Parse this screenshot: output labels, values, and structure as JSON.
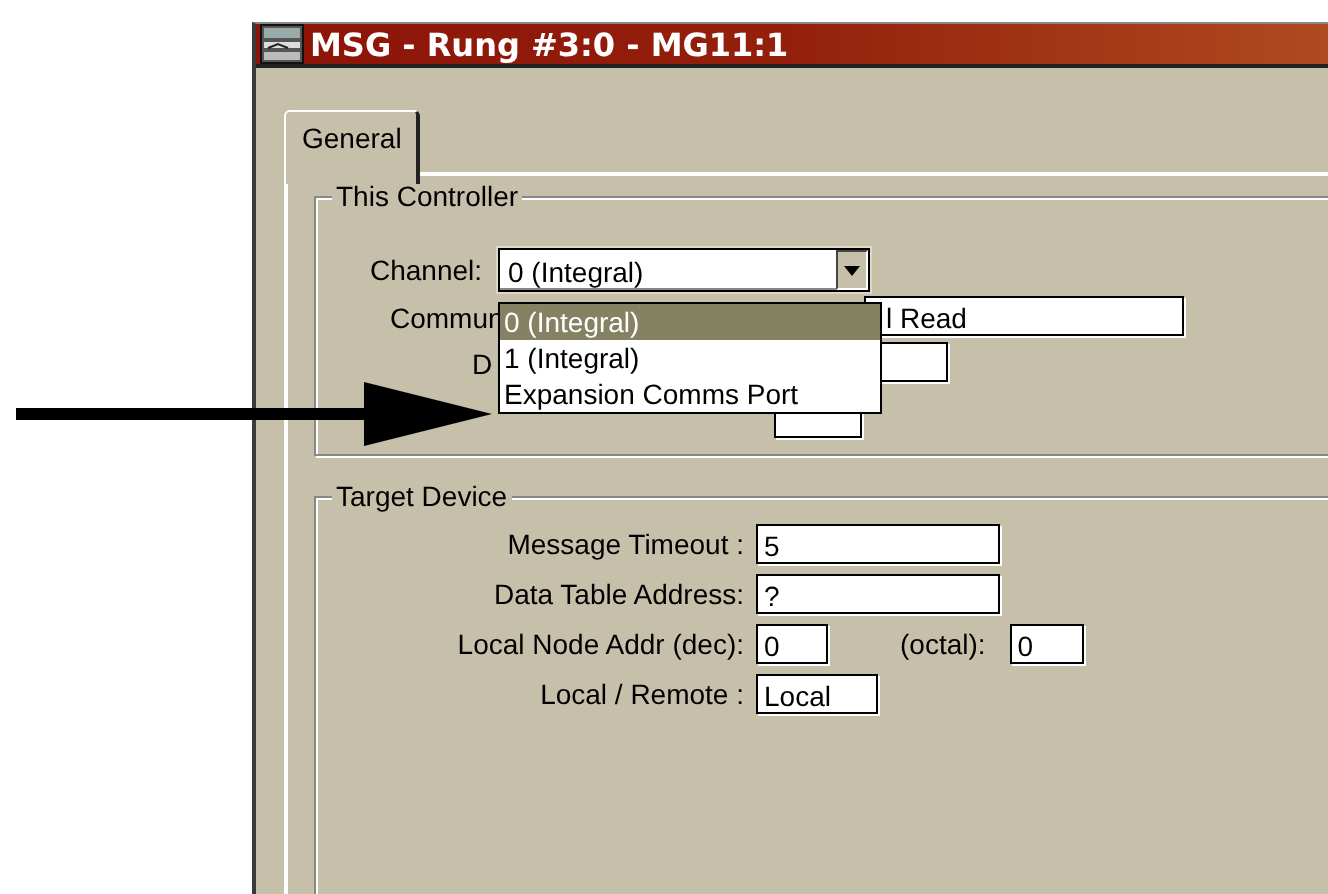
{
  "window": {
    "title": "MSG - Rung #3:0 - MG11:1"
  },
  "tabs": [
    {
      "label": "General",
      "selected": true
    }
  ],
  "this_controller": {
    "title": "This Controller",
    "channel": {
      "label": "Channel:",
      "value": "0 (Integral)",
      "expanded": true,
      "options": [
        {
          "label": "0 (Integral)",
          "selected": true
        },
        {
          "label": "1 (Integral)",
          "selected": false
        },
        {
          "label": "Expansion Comms Port",
          "selected": false
        }
      ]
    },
    "fields": [
      {
        "label": "Commun",
        "value": "l Read"
      },
      {
        "label": "D"
      }
    ]
  },
  "target_device": {
    "title": "Target Device",
    "fields": [
      {
        "label": "Message Timeout :",
        "value": "5"
      },
      {
        "label": "Data Table Address:",
        "value": "?"
      },
      {
        "label": "Local Node Addr (dec):",
        "value": "0",
        "extra_label": "(octal):",
        "extra_value": "0"
      },
      {
        "label": "Local / Remote :",
        "value": "Local"
      }
    ]
  }
}
